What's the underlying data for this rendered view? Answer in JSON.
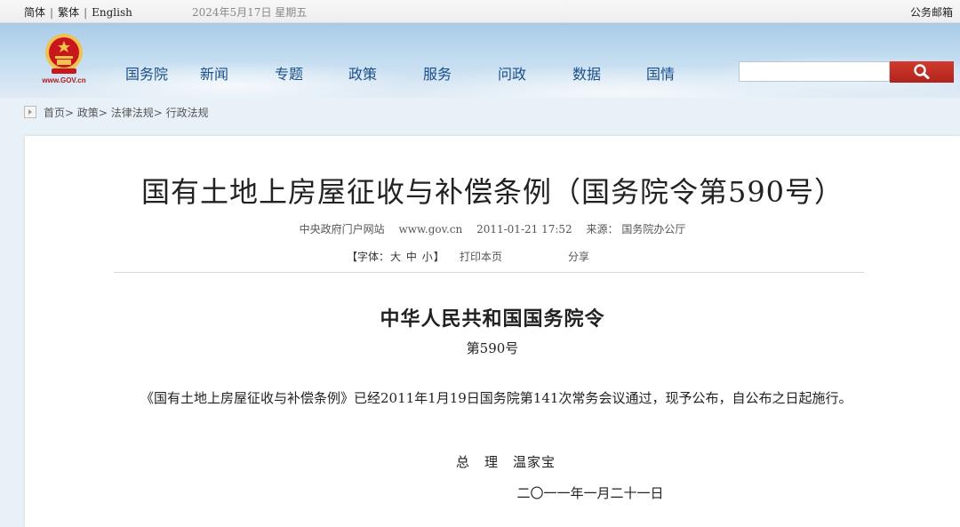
{
  "topbar": {
    "lang_simplified": "简体",
    "lang_traditional": "繁体",
    "lang_english": "English",
    "date": "2024年5月17日 星期五",
    "mail": "公务邮箱"
  },
  "header": {
    "logo_text": "www.GOV.cn",
    "nav": [
      "国务院",
      "新闻",
      "专题",
      "政策",
      "服务",
      "问政",
      "数据",
      "国情"
    ],
    "search_placeholder": ""
  },
  "breadcrumb": [
    "首页",
    "政策",
    "法律法规",
    "行政法规"
  ],
  "article": {
    "title": "国有土地上房屋征收与补偿条例（国务院令第590号）",
    "meta_source": "中央政府门户网站",
    "meta_site": "www.gov.cn",
    "meta_time": "2011-01-21 17:52",
    "meta_origin": "来源：  国务院办公厅",
    "font_label": "【字体：",
    "font_large": "大",
    "font_medium": "中",
    "font_small": "小",
    "font_close": "】",
    "print": "打印本页",
    "share": "分享",
    "order_head": "中华人民共和国国务院令",
    "order_no": "第590号",
    "body": "《国有土地上房屋征收与补偿条例》已经2011年1月19日国务院第141次常务会议通过，现予公布，自公布之日起施行。",
    "signature": "总　理　温家宝",
    "sign_date": "二〇一一年一月二十一日"
  },
  "colors": {
    "nav_text": "#1a4f8a",
    "search_button": "#c0302a",
    "emblem_red": "#c8161d",
    "emblem_gold": "#f2c14e"
  }
}
